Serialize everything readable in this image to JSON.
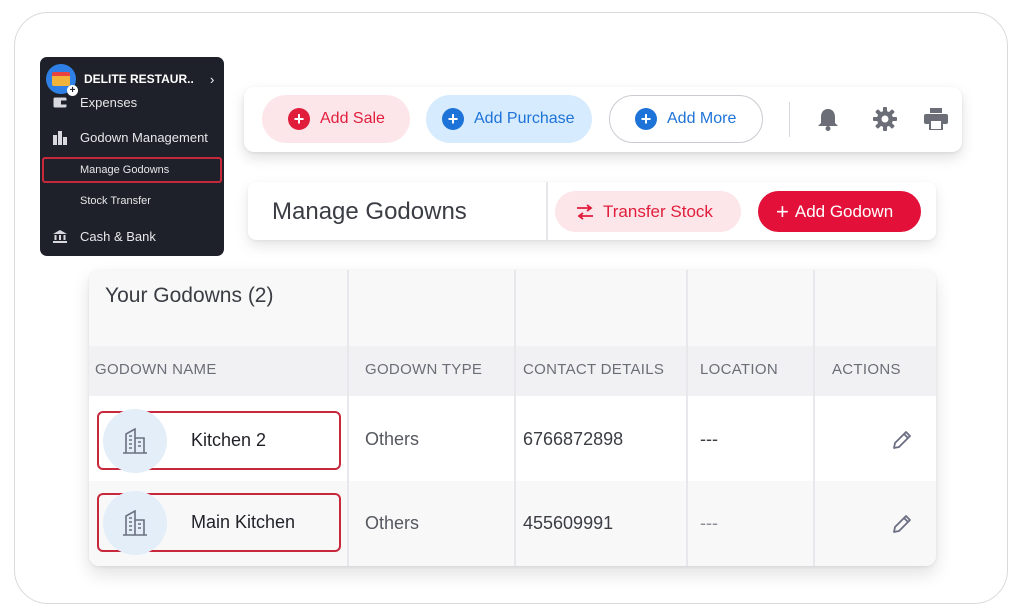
{
  "sidebar": {
    "company": "DELITE RESTAUR...",
    "items": {
      "expenses": "Expenses",
      "godown_management": "Godown Management",
      "manage_godowns": "Manage Godowns",
      "stock_transfer": "Stock Transfer",
      "cash_bank": "Cash & Bank"
    }
  },
  "toolbar": {
    "add_sale": "Add Sale",
    "add_purchase": "Add Purchase",
    "add_more": "Add More",
    "icons": [
      "bell-icon",
      "gear-icon",
      "printer-icon"
    ]
  },
  "header": {
    "title": "Manage Godowns",
    "transfer_stock": "Transfer Stock",
    "add_godown": "Add Godown"
  },
  "table": {
    "title": "Your Godowns (2)",
    "columns": [
      "GODOWN NAME",
      "GODOWN TYPE",
      "CONTACT DETAILS",
      "LOCATION",
      "ACTIONS"
    ],
    "rows": [
      {
        "name": "Kitchen 2",
        "type": "Others",
        "contact": "6766872898",
        "location": "---"
      },
      {
        "name": "Main Kitchen",
        "type": "Others",
        "contact": "455609991",
        "location": "---"
      }
    ]
  },
  "colors": {
    "accent_red": "#e3113a",
    "accent_blue": "#1e73d8",
    "sidebar_bg": "#1e2129",
    "highlight_border": "#c8283c"
  }
}
